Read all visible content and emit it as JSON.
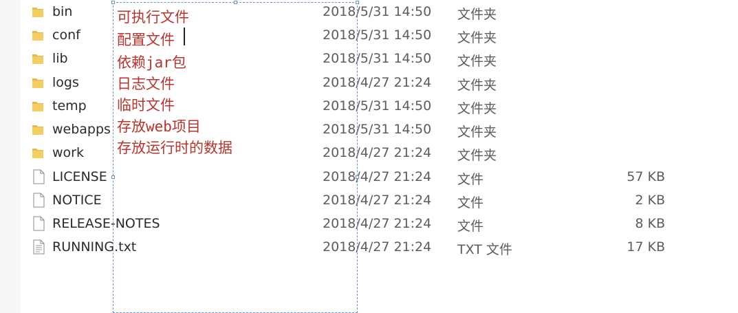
{
  "files": [
    {
      "name": "bin",
      "date": "2018/5/31 14:50",
      "type": "文件夹",
      "size": "",
      "icon": "folder-icon"
    },
    {
      "name": "conf",
      "date": "2018/5/31 14:50",
      "type": "文件夹",
      "size": "",
      "icon": "folder-icon"
    },
    {
      "name": "lib",
      "date": "2018/5/31 14:50",
      "type": "文件夹",
      "size": "",
      "icon": "folder-icon"
    },
    {
      "name": "logs",
      "date": "2018/4/27 21:24",
      "type": "文件夹",
      "size": "",
      "icon": "folder-icon"
    },
    {
      "name": "temp",
      "date": "2018/5/31 14:50",
      "type": "文件夹",
      "size": "",
      "icon": "folder-icon"
    },
    {
      "name": "webapps",
      "date": "2018/5/31 14:50",
      "type": "文件夹",
      "size": "",
      "icon": "folder-icon"
    },
    {
      "name": "work",
      "date": "2018/4/27 21:24",
      "type": "文件夹",
      "size": "",
      "icon": "folder-icon"
    },
    {
      "name": "LICENSE",
      "date": "2018/4/27 21:24",
      "type": "文件",
      "size": "57 KB",
      "icon": "file-icon"
    },
    {
      "name": "NOTICE",
      "date": "2018/4/27 21:24",
      "type": "文件",
      "size": "2 KB",
      "icon": "file-icon"
    },
    {
      "name": "RELEASE-NOTES",
      "date": "2018/4/27 21:24",
      "type": "文件",
      "size": "8 KB",
      "icon": "file-icon"
    },
    {
      "name": "RUNNING.txt",
      "date": "2018/4/27 21:24",
      "type": "TXT 文件",
      "size": "17 KB",
      "icon": "text-file-icon"
    }
  ],
  "annotations": [
    "可执行文件",
    "配置文件",
    "依赖jar包",
    "日志文件",
    "临时文件",
    "存放web项目",
    "存放运行时的数据"
  ],
  "colors": {
    "annotation_text": "#b8342c",
    "selection_border": "#6b8fc0",
    "folder": "#e8b84a"
  }
}
